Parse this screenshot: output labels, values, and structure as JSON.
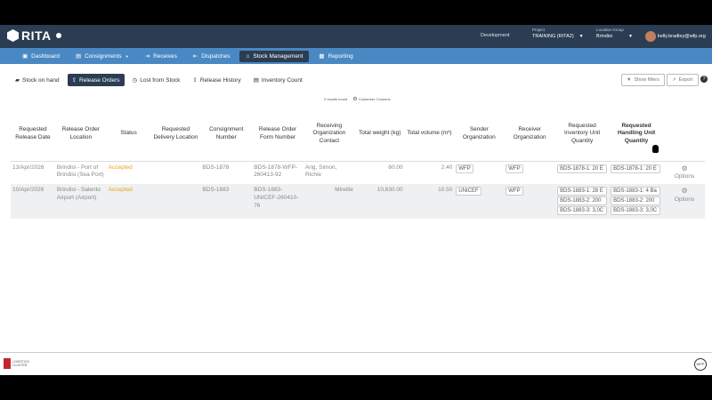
{
  "header": {
    "app_name": "RITA",
    "environment": "Development",
    "project_label": "Project",
    "project_value": "TRAINING (RITA2)",
    "location_label": "Location Group",
    "location_value": "Brindisi",
    "user_email": "kelly.bradley@wfp.org"
  },
  "nav": {
    "items": [
      {
        "label": "Dashboard",
        "icon": "dashboard-icon"
      },
      {
        "label": "Consignments",
        "icon": "consignments-icon"
      },
      {
        "label": "Receives",
        "icon": "receives-icon"
      },
      {
        "label": "Dispatches",
        "icon": "dispatches-icon"
      },
      {
        "label": "Stock Management",
        "icon": "warehouse-icon",
        "active": true
      },
      {
        "label": "Reporting",
        "icon": "reporting-icon"
      }
    ]
  },
  "subtabs": [
    {
      "label": "Stock on hand"
    },
    {
      "label": "Release Orders",
      "active": true
    },
    {
      "label": "Lost from Stock"
    },
    {
      "label": "Release History"
    },
    {
      "label": "Inventory Count"
    }
  ],
  "toolbar": {
    "show_filters": "Show filters",
    "export": "Export",
    "results": "2 results found",
    "customize": "Customize Columns"
  },
  "table": {
    "headers": [
      "Requested Release Date",
      "Release Order Location",
      "Status",
      "Requested Delivery Location",
      "Consignment Number",
      "Release Order Form Number",
      "Receiving Organization Contact",
      "Total weight (kg)",
      "Total volume (m³)",
      "Sender Organization",
      "Receiver Organization",
      "Requested Inventory Unit Quantity",
      "Requested Handling Unit Quantity"
    ],
    "rows": [
      {
        "date": "13/Apr/2026",
        "location": "Brindisi - Port of Brindisi (Sea Port)",
        "status": "Accepted",
        "delivery": "",
        "consignment": "BDS-1878",
        "form": "BDS-1878-WFP-260413-92",
        "contact": "Arig, Simon, Richie",
        "weight": "60.00",
        "volume": "2.40",
        "sender": "WFP",
        "receiver": "WFP",
        "inv_units": [
          "BDS-1878-1: 20 E"
        ],
        "handling_units": [
          "BDS-1878-1: 20 E"
        ],
        "options": "Options"
      },
      {
        "date": "10/Apr/2026",
        "location": "Brindisi - Salento Airport (Airport)",
        "status": "Accepted",
        "delivery": "",
        "consignment": "BDS-1883",
        "form": "BDS-1883-UNICEF-260410-76",
        "contact": "Mireille",
        "weight": "10,630.00",
        "volume": "10.50",
        "sender": "UNICEF",
        "receiver": "WFP",
        "inv_units": [
          "BDS-1883-1: 28 E",
          "BDS-1883-2: 200",
          "BDS-1883-3: 3,0C"
        ],
        "handling_units": [
          "BDS-1883-1: 4 Ba",
          "BDS-1883-2: 200",
          "BDS-1883-3: 3,0C"
        ],
        "options": "Options"
      }
    ]
  },
  "footer": {
    "left_logo_text": "LOGISTICS CLUSTER",
    "right_logo_text": "WFP"
  }
}
